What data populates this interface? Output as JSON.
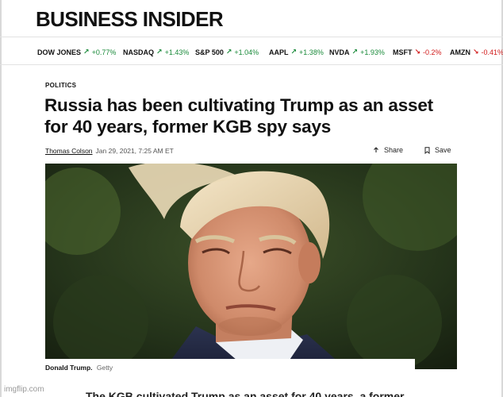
{
  "logo": "BUSINESS INSIDER",
  "ticker": [
    {
      "symbol": "DOW JONES",
      "change": "+0.77%",
      "direction": "up"
    },
    {
      "symbol": "NASDAQ",
      "change": "+1.43%",
      "direction": "up"
    },
    {
      "symbol": "S&P 500",
      "change": "+1.04%",
      "direction": "up"
    },
    {
      "symbol": "AAPL",
      "change": "+1.38%",
      "direction": "up"
    },
    {
      "symbol": "NVDA",
      "change": "+1.93%",
      "direction": "up"
    },
    {
      "symbol": "MSFT",
      "change": "-0.2%",
      "direction": "down"
    },
    {
      "symbol": "AMZN",
      "change": "-0.41%",
      "direction": "down"
    }
  ],
  "article": {
    "section": "POLITICS",
    "headline": "Russia has been cultivating Trump as an asset for 40 years, former KGB spy says",
    "author": "Thomas Colson",
    "date": "Jan 29, 2021, 7:25 AM ET",
    "share_label": "Share",
    "save_label": "Save",
    "caption_name": "Donald Trump.",
    "caption_credit": "Getty",
    "body_fragment": "The KGB cultivated Trump as an asset for 40 years, a former"
  },
  "watermark": "imgflip.com",
  "colors": {
    "up": "#1a8a3a",
    "down": "#d11a1a"
  }
}
